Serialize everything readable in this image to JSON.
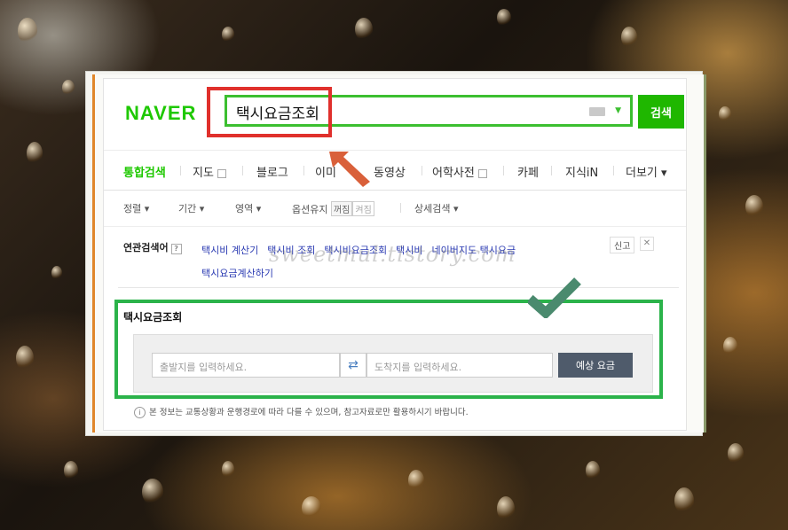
{
  "header": {
    "logo_text": "NAVER",
    "search_query": "택시요금조회",
    "search_button_label": "검색",
    "keyboard_icon": "keyboard-icon",
    "dropdown_icon": "chevron-down-icon"
  },
  "nav": {
    "tabs": [
      {
        "label": "통합검색",
        "active": true
      },
      {
        "label": "지도"
      },
      {
        "label": "블로그"
      },
      {
        "label": "이미"
      },
      {
        "label": "동영상"
      },
      {
        "label": "어학사전"
      },
      {
        "label": "카페"
      },
      {
        "label": "지식iN"
      },
      {
        "label": "더보기 ▾"
      }
    ]
  },
  "filters": {
    "sort": "정렬 ▾",
    "period": "기간 ▾",
    "area": "영역 ▾",
    "option_keep": "옵션유지",
    "toggle_off": "꺼짐",
    "toggle_on": "켜짐",
    "detail_search": "상세검색 ▾"
  },
  "related": {
    "label": "연관검색어",
    "help": "?",
    "links": [
      "택시비 계산기",
      "택시비 조회",
      "택시비요금조회",
      "택시비",
      "네이버지도 택시요금",
      "택시요금계산하기"
    ],
    "report": "신고",
    "close": "✕"
  },
  "watermark": "sweetmul.tistory.com",
  "fare": {
    "title": "택시요금조회",
    "origin_placeholder": "출발지를 입력하세요.",
    "destination_placeholder": "도착지를 입력하세요.",
    "estimate_button": "예상 요금",
    "notice": "본 정보는 교통상황과 운행경로에 따라 다를 수 있으며, 참고자료로만 활용하시기 바랍니다."
  },
  "colors": {
    "naver_green": "#1ec800",
    "highlight_red": "#e0302c",
    "highlight_green": "#2bb34a",
    "arrow_orange": "#d9603a",
    "check_teal": "#4a8a6e"
  }
}
